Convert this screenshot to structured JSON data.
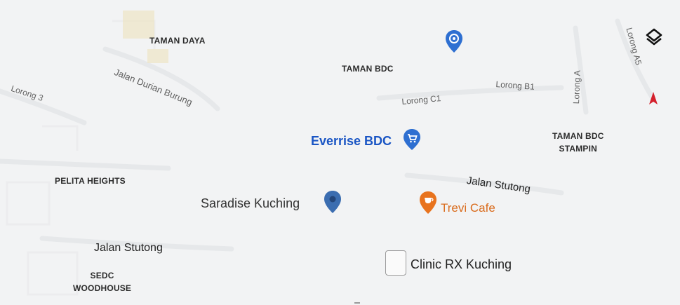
{
  "areas": {
    "taman_daya": "TAMAN DAYA",
    "taman_bdc": "TAMAN BDC",
    "taman_bdc_stampin_1": "TAMAN BDC",
    "taman_bdc_stampin_2": "STAMPIN",
    "pelita_heights": "PELITA HEIGHTS",
    "sedc_1": "SEDC",
    "sedc_2": "WOODHOUSE"
  },
  "roads": {
    "jalan_durian_burung": "Jalan Durian Burung",
    "lorong_3": "Lorong 3",
    "lorong_c1": "Lorong C1",
    "lorong_b1": "Lorong B1",
    "lorong_a": "Lorong A",
    "lorong_a5": "Lorong A5",
    "jalan_stutong_east": "Jalan Stutong",
    "jalan_stutong_west": "Jalan Stutong"
  },
  "places": {
    "everrise": "Everrise BDC",
    "saradise": "Saradise Kuching",
    "trevi": "Trevi Cafe",
    "clinic": "Clinic RX Kuching"
  },
  "colors": {
    "map_bg": "#f2f3f4",
    "poi_blue": "#1a55c4",
    "pin_blue": "#2e6fd1",
    "pin_dark_blue": "#3b6db0",
    "pin_orange": "#e8731e",
    "compass_red": "#d4202c"
  },
  "icons": {
    "shopping_pin": "shopping-cart-pin-icon",
    "place_pin": "place-pin-icon",
    "cafe_pin": "cafe-pin-icon",
    "generic_pin": "blue-pin-icon",
    "layers": "layers-icon",
    "compass": "compass-icon",
    "clinic": "clinic-placeholder-icon"
  }
}
